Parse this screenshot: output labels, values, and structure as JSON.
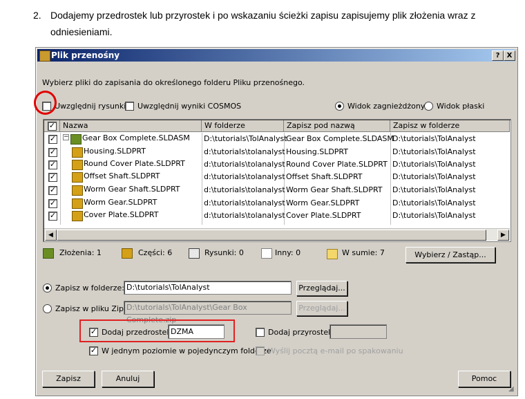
{
  "doc": {
    "number": "2.",
    "line1": "Dodajemy przedrostek lub przyrostek i po wskazaniu  ścieżki zapisu zapisujemy plik złożenia wraz z",
    "line2": "odniesieniami."
  },
  "dialog": {
    "title": "Plik przenośny",
    "help_btn": "?",
    "close_btn": "X",
    "instruction": "Wybierz pliki do zapisania do określonego folderu Pliku przenośnego.",
    "include_drawings": "Uwzględnij rysunki",
    "include_cosmos": "Uwzględnij wyniki COSMOS",
    "nested_view": "Widok zagnieżdżony",
    "flat_view": "Widok płaski"
  },
  "table": {
    "headers": [
      "Nazwa",
      "W folderze",
      "Zapisz pod nazwą",
      "Zapisz w folderze"
    ],
    "rows": [
      {
        "name": "Gear Box Complete.SLDASM",
        "folder": "D:\\tutorials\\TolAnalyst",
        "save_as": "Gear Box Complete.SLDASM",
        "save_folder": "D:\\tutorials\\TolAnalyst"
      },
      {
        "name": "Housing.SLDPRT",
        "folder": "d:\\tutorials\\tolanalyst",
        "save_as": "Housing.SLDPRT",
        "save_folder": "D:\\tutorials\\TolAnalyst"
      },
      {
        "name": "Round Cover Plate.SLDPRT",
        "folder": "d:\\tutorials\\tolanalyst",
        "save_as": "Round Cover Plate.SLDPRT",
        "save_folder": "D:\\tutorials\\TolAnalyst"
      },
      {
        "name": "Offset Shaft.SLDPRT",
        "folder": "d:\\tutorials\\tolanalyst",
        "save_as": "Offset Shaft.SLDPRT",
        "save_folder": "D:\\tutorials\\TolAnalyst"
      },
      {
        "name": "Worm Gear Shaft.SLDPRT",
        "folder": "d:\\tutorials\\tolanalyst",
        "save_as": "Worm Gear Shaft.SLDPRT",
        "save_folder": "D:\\tutorials\\TolAnalyst"
      },
      {
        "name": "Worm Gear.SLDPRT",
        "folder": "d:\\tutorials\\tolanalyst",
        "save_as": "Worm Gear.SLDPRT",
        "save_folder": "D:\\tutorials\\TolAnalyst"
      },
      {
        "name": "Cover Plate.SLDPRT",
        "folder": "d:\\tutorials\\tolanalyst",
        "save_as": "Cover Plate.SLDPRT",
        "save_folder": "D:\\tutorials\\TolAnalyst"
      }
    ]
  },
  "stats": {
    "assemblies": "Złożenia: 1",
    "parts": "Części: 6",
    "drawings": "Rysunki: 0",
    "other": "Inny: 0",
    "total": "W sumie: 7",
    "select_replace": "Wybierz / Zastąp..."
  },
  "save": {
    "to_folder_label": "Zapisz w folderze:",
    "to_folder_value": "D:\\tutorials\\TolAnalyst",
    "browse1": "Przeglądaj...",
    "to_zip_label": "Zapisz w pliku Zip:",
    "to_zip_value": "D:\\tutorials\\TolAnalyst\\Gear Box Complete.zip",
    "browse2": "Przeglądaj...",
    "add_prefix": "Dodaj przedrostek:",
    "prefix_value": "DZMA",
    "add_suffix": "Dodaj przyrostek:",
    "single_level": "W jednym poziomie w pojedynczym folderze",
    "email": "Wyślij pocztą e-mail po spakowaniu"
  },
  "buttons": {
    "save": "Zapisz",
    "cancel": "Anuluj",
    "help": "Pomoc"
  },
  "colors": {
    "highlight": "#e00000",
    "titlebar": "#0a246a"
  }
}
